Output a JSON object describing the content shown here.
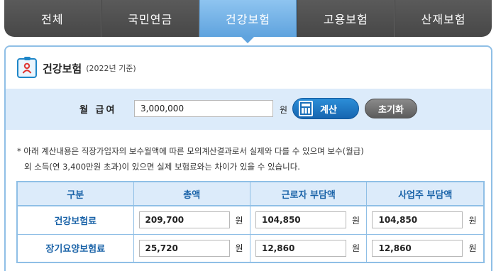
{
  "tabs": [
    {
      "label": "전체",
      "active": false
    },
    {
      "label": "국민연금",
      "active": false
    },
    {
      "label": "건강보험",
      "active": true
    },
    {
      "label": "고용보험",
      "active": false
    },
    {
      "label": "산재보험",
      "active": false
    }
  ],
  "section": {
    "title": "건강보험",
    "subtitle": "(2022년 기준)",
    "icon": "clipboard-person-icon"
  },
  "salary": {
    "label": "월 급여",
    "value": "3,000,000",
    "unit": "원",
    "calc_button": "계산",
    "reset_button": "초기화"
  },
  "note": {
    "line1": "* 아래 계산내용은 직장가입자의 보수월액에 따른 모의계산결과로서 실제와 다를 수 있으며 보수(월급)",
    "line2": "외 소득(연 3,400만원 초과)이 있으면 실제 보험료와는 차이가 있을 수 있습니다."
  },
  "table": {
    "headers": [
      "구분",
      "총액",
      "근로자 부담액",
      "사업주 부담액"
    ],
    "unit": "원",
    "rows": [
      {
        "label": "건강보험료",
        "total": "209,700",
        "employee": "104,850",
        "employer": "104,850"
      },
      {
        "label": "장기요양보험료",
        "total": "25,720",
        "employee": "12,860",
        "employer": "12,860"
      }
    ]
  },
  "colors": {
    "accent": "#5fa3de",
    "header_blue": "#1a63a8",
    "band_bg": "#dcebfa",
    "tabbar_bg": "#4f4f4f"
  }
}
